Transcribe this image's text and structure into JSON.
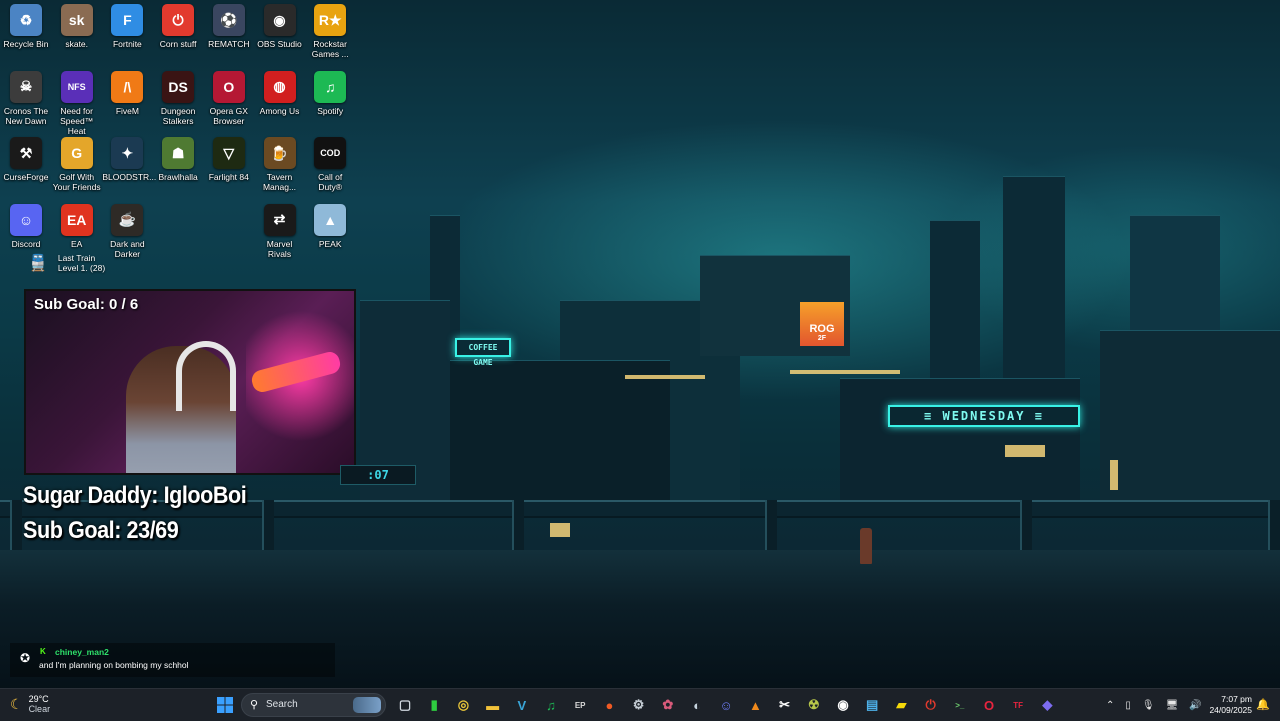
{
  "desktop_icons": [
    {
      "label": "Recycle Bin",
      "glyph": "♻",
      "color": "#4b84c4",
      "col": 0,
      "row": 0
    },
    {
      "label": "skate.",
      "glyph": "sk",
      "color": "#8a6b52",
      "col": 1,
      "row": 0
    },
    {
      "label": "Fortnite",
      "glyph": "F",
      "color": "#2f8de4",
      "col": 2,
      "row": 0
    },
    {
      "label": "Corn stuff",
      "glyph": "⏻",
      "color": "#e23a2e",
      "col": 3,
      "row": 0
    },
    {
      "label": "REMATCH",
      "glyph": "⚽",
      "color": "#3a4660",
      "col": 4,
      "row": 0
    },
    {
      "label": "OBS Studio",
      "glyph": "◉",
      "color": "#2a2a2a",
      "col": 5,
      "row": 0
    },
    {
      "label": "Rockstar Games ...",
      "glyph": "R★",
      "color": "#e8a310",
      "col": 6,
      "row": 0
    },
    {
      "label": "Cronos The New Dawn",
      "glyph": "☠",
      "color": "#3c3c3c",
      "col": 0,
      "row": 1
    },
    {
      "label": "Need for Speed™ Heat",
      "glyph": "NFS",
      "color": "#5a2fb8",
      "col": 1,
      "row": 1
    },
    {
      "label": "FiveM",
      "glyph": "/\\",
      "color": "#f07a16",
      "col": 2,
      "row": 1
    },
    {
      "label": "Dungeon Stalkers",
      "glyph": "DS",
      "color": "#3a1414",
      "col": 3,
      "row": 1
    },
    {
      "label": "Opera GX Browser",
      "glyph": "O",
      "color": "#b51834",
      "col": 4,
      "row": 1
    },
    {
      "label": "Among Us",
      "glyph": "◍",
      "color": "#d11f1f",
      "col": 5,
      "row": 1
    },
    {
      "label": "Spotify",
      "glyph": "♫",
      "color": "#1db954",
      "col": 6,
      "row": 1
    },
    {
      "label": "CurseForge",
      "glyph": "⚒",
      "color": "#1a1a1a",
      "col": 0,
      "row": 2
    },
    {
      "label": "Golf With Your Friends",
      "glyph": "G",
      "color": "#e4a62a",
      "col": 1,
      "row": 2
    },
    {
      "label": "BLOODSTR...",
      "glyph": "✦",
      "color": "#1b3a52",
      "col": 2,
      "row": 2
    },
    {
      "label": "Brawlhalla",
      "glyph": "☗",
      "color": "#4f7a32",
      "col": 3,
      "row": 2
    },
    {
      "label": "Farlight 84",
      "glyph": "▽",
      "color": "#1e2a12",
      "col": 4,
      "row": 2
    },
    {
      "label": "Tavern Manag...",
      "glyph": "🍺",
      "color": "#6b4a22",
      "col": 5,
      "row": 2
    },
    {
      "label": "Call of Duty®",
      "glyph": "COD",
      "color": "#111111",
      "col": 6,
      "row": 2
    },
    {
      "label": "Discord",
      "glyph": "☺",
      "color": "#5865f2",
      "col": 0,
      "row": 3
    },
    {
      "label": "EA",
      "glyph": "EA",
      "color": "#e0331f",
      "col": 1,
      "row": 3
    },
    {
      "label": "Dark and Darker",
      "glyph": "☕",
      "color": "#2e2a26",
      "col": 2,
      "row": 3
    },
    {
      "label": "Marvel Rivals",
      "glyph": "⇄",
      "color": "#1a1a1a",
      "col": 5,
      "row": 3
    },
    {
      "label": "PEAK",
      "glyph": "▲",
      "color": "#8fb9d8",
      "col": 6,
      "row": 3
    }
  ],
  "widget": {
    "line1": "Last Train",
    "line2": "Level 1. (28)"
  },
  "stream": {
    "cam_sub_goal": "Sub Goal: 0 / 6",
    "overlay_line1": "Sugar Daddy: IglooBoi",
    "overlay_line2": "Sub Goal: 23/69",
    "timer": ":07"
  },
  "signs": {
    "coffee": "COFFEE GAME",
    "neon": "≡ WEDNESDAY ≡",
    "rog": "ROG",
    "rog_sub": "2F"
  },
  "chat": {
    "username": "chiney_man2",
    "message": "and I'm planning on bombing my schhol",
    "badge": "K"
  },
  "taskbar": {
    "weather_temp": "29°C",
    "weather_desc": "Clear",
    "search_label": "Search",
    "apps": [
      {
        "name": "task-view",
        "glyph": "▢",
        "color": "#cfd6de"
      },
      {
        "name": "xbox",
        "glyph": "▮",
        "color": "#2ecc40"
      },
      {
        "name": "chrome",
        "glyph": "◎",
        "color": "#e8c53a"
      },
      {
        "name": "file-explorer",
        "glyph": "▬",
        "color": "#f2c23a"
      },
      {
        "name": "visual-studio",
        "glyph": "V",
        "color": "#3aa6d8"
      },
      {
        "name": "spotify",
        "glyph": "♫",
        "color": "#1db954"
      },
      {
        "name": "epic-games",
        "glyph": "EP",
        "color": "#d8d8d8"
      },
      {
        "name": "origin",
        "glyph": "●",
        "color": "#f05a23"
      },
      {
        "name": "settings",
        "glyph": "⚙",
        "color": "#c8d0d8"
      },
      {
        "name": "davinci",
        "glyph": "✿",
        "color": "#d85a7a"
      },
      {
        "name": "steam",
        "glyph": "◐",
        "color": "#c7d5e0"
      },
      {
        "name": "discord",
        "glyph": "☺",
        "color": "#6c7cf5"
      },
      {
        "name": "vlc",
        "glyph": "▲",
        "color": "#f08a1c"
      },
      {
        "name": "capcut",
        "glyph": "✂",
        "color": "#ffffff"
      },
      {
        "name": "game-app",
        "glyph": "☢",
        "color": "#b8c84a"
      },
      {
        "name": "obs",
        "glyph": "◉",
        "color": "#ffffff"
      },
      {
        "name": "photos",
        "glyph": "▤",
        "color": "#4db0e8"
      },
      {
        "name": "sticky-notes",
        "glyph": "▰",
        "color": "#f5d90a"
      },
      {
        "name": "corn-stuff",
        "glyph": "⏻",
        "color": "#e23a2e"
      },
      {
        "name": "terminal",
        "glyph": ">_",
        "color": "#6fcf6f"
      },
      {
        "name": "opera-gx",
        "glyph": "O",
        "color": "#e8243f"
      },
      {
        "name": "fastly",
        "glyph": "TF",
        "color": "#e8243f"
      },
      {
        "name": "vpn",
        "glyph": "◆",
        "color": "#7d6cf0"
      }
    ],
    "time": "7:07 pm",
    "date": "24/09/2025"
  }
}
